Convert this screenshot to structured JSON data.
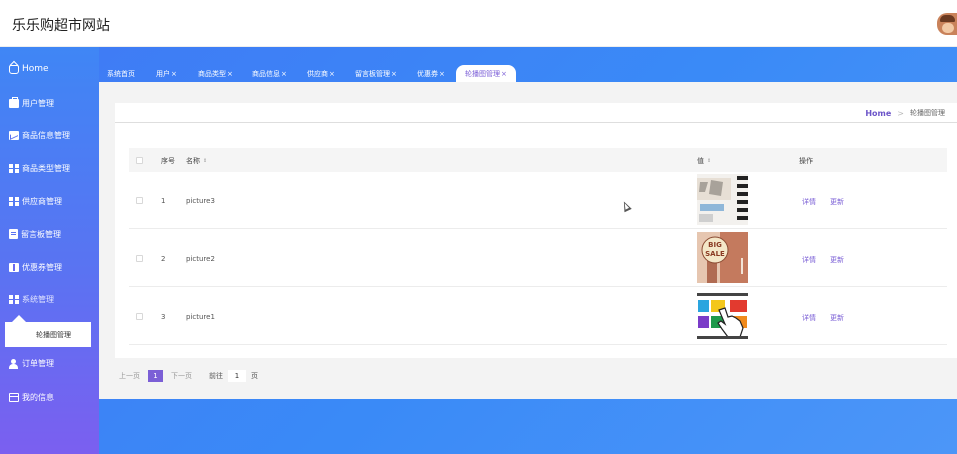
{
  "site": {
    "title": "乐乐购超市网站"
  },
  "sidebar": {
    "items": [
      {
        "label": "Home",
        "icon": "home-icon"
      },
      {
        "label": "用户管理",
        "icon": "briefcase-icon"
      },
      {
        "label": "商品信息管理",
        "icon": "chart-icon"
      },
      {
        "label": "商品类型管理",
        "icon": "grid-icon"
      },
      {
        "label": "供应商管理",
        "icon": "grid-icon"
      },
      {
        "label": "留言板管理",
        "icon": "clipboard-icon"
      },
      {
        "label": "优惠券管理",
        "icon": "ticket-icon"
      },
      {
        "label": "系统管理",
        "icon": "grid-icon"
      },
      {
        "label": "订单管理",
        "icon": "user-icon"
      },
      {
        "label": "我的信息",
        "icon": "card-icon"
      }
    ],
    "submenu": {
      "label": "轮播图管理"
    }
  },
  "tabs": [
    {
      "label": "系统首页",
      "closable": false
    },
    {
      "label": "用户",
      "closable": true
    },
    {
      "label": "商品类型",
      "closable": true
    },
    {
      "label": "商品信息",
      "closable": true
    },
    {
      "label": "供应商",
      "closable": true
    },
    {
      "label": "留言板管理",
      "closable": true
    },
    {
      "label": "优惠券",
      "closable": true
    },
    {
      "label": "轮播图管理",
      "closable": true,
      "active": true
    }
  ],
  "close_glyph": "×",
  "breadcrumb": {
    "home": "Home",
    "separator": ">",
    "current": "轮播图管理"
  },
  "table": {
    "headers": {
      "index": "序号",
      "name": "名称",
      "value": "值",
      "actions": "操作"
    },
    "sort_glyph": "⇕",
    "rows": [
      {
        "index": "1",
        "name": "picture3",
        "detail": "详情",
        "update": "更新"
      },
      {
        "index": "2",
        "name": "picture2",
        "detail": "详情",
        "update": "更新"
      },
      {
        "index": "3",
        "name": "picture1",
        "detail": "详情",
        "update": "更新"
      }
    ],
    "thumb_texts": {
      "big": "BIG",
      "sale": "SALE"
    }
  },
  "pagination": {
    "prev": "上一页",
    "current_page": "1",
    "next": "下一页",
    "goto_label": "前往",
    "goto_value": "1",
    "unit": "页"
  },
  "colors": {
    "accent": "#7b5fd6",
    "sidebar_top": "#3f86f5",
    "sidebar_bottom": "#7b5ff0",
    "content_blue": "#3a8af7"
  }
}
